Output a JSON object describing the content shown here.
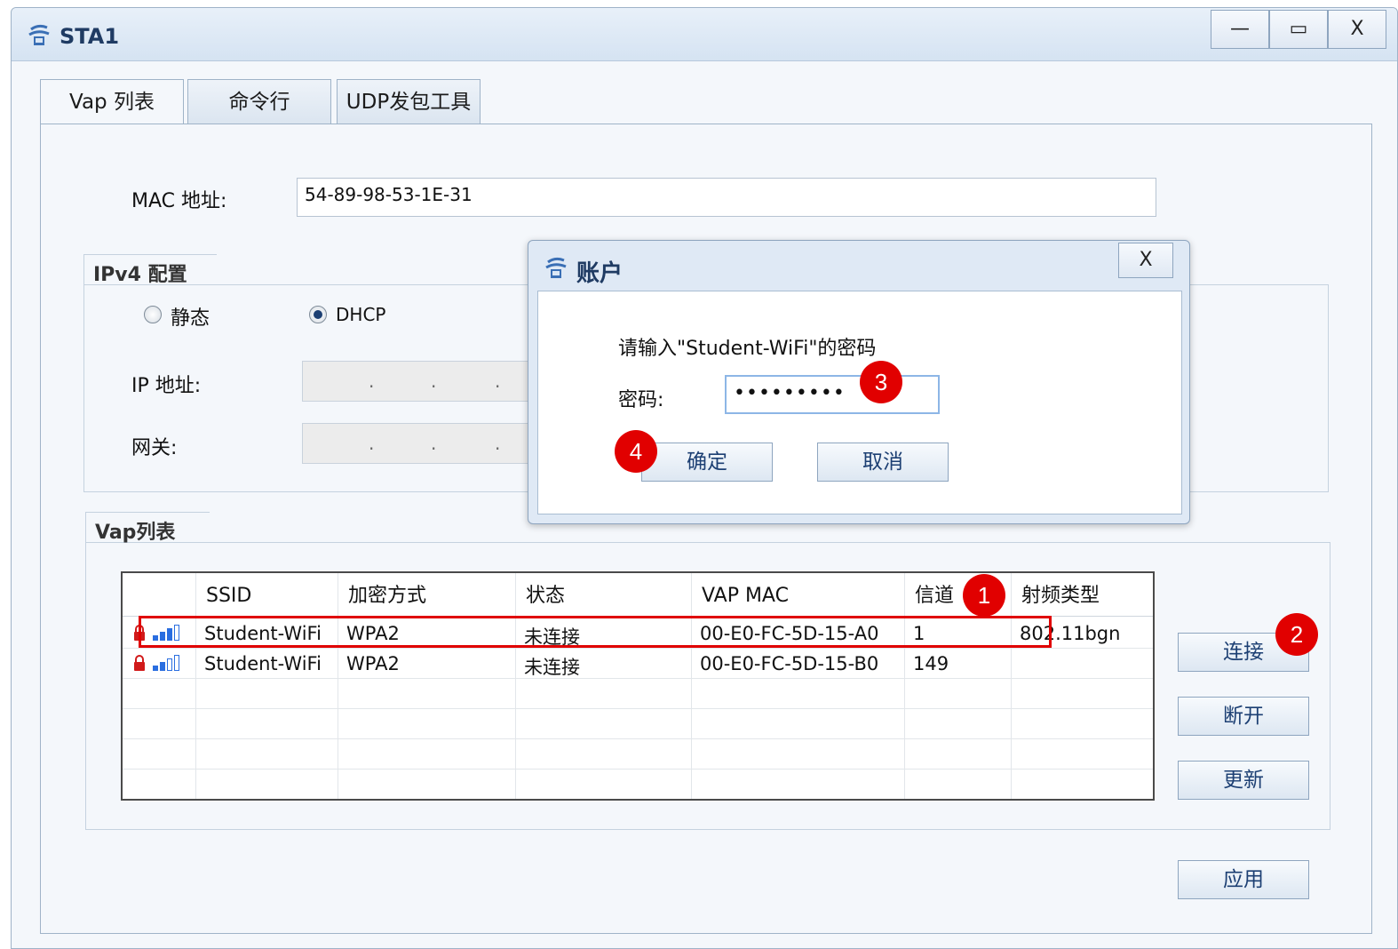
{
  "window": {
    "title": "STA1",
    "minimize_label": "—",
    "maximize_label": "▭",
    "close_label": "X"
  },
  "tabs": [
    "Vap 列表",
    "命令行",
    "UDP发包工具"
  ],
  "mac": {
    "label": "MAC 地址:",
    "value": "54-89-98-53-1E-31"
  },
  "ipv4": {
    "title": "IPv4 配置",
    "static_label": "静态",
    "dhcp_label": "DHCP",
    "selected": "DHCP",
    "ip_label": "IP 地址:",
    "gateway_label": "网关:",
    "ip_dots": ".",
    "gw_dots": "."
  },
  "vap": {
    "title": "Vap列表",
    "columns": [
      "SSID",
      "加密方式",
      "状态",
      "VAP MAC",
      "信道",
      "射频类型"
    ],
    "rows": [
      {
        "ssid": "Student-WiFi",
        "encryption": "WPA2",
        "status": "未连接",
        "vap_mac": "00-E0-FC-5D-15-A0",
        "channel": "1",
        "radio": "802.11bgn",
        "signal_bars": 3
      },
      {
        "ssid": "Student-WiFi",
        "encryption": "WPA2",
        "status": "未连接",
        "vap_mac": "00-E0-FC-5D-15-B0",
        "channel": "149",
        "radio": "",
        "signal_bars": 2
      }
    ]
  },
  "buttons": {
    "connect": "连接",
    "disconnect": "断开",
    "refresh": "更新",
    "apply": "应用"
  },
  "dialog": {
    "title": "账户",
    "close_label": "X",
    "prompt": "请输入\"Student-WiFi\"的密码",
    "password_label": "密码:",
    "password_value": "•••••••••",
    "ok": "确定",
    "cancel": "取消"
  },
  "annotations": [
    "1",
    "2",
    "3",
    "4"
  ],
  "colors": {
    "accent": "#1c3f73",
    "highlight": "#e00000",
    "signal": "#2a6ee0",
    "lock": "#d11a1a"
  }
}
